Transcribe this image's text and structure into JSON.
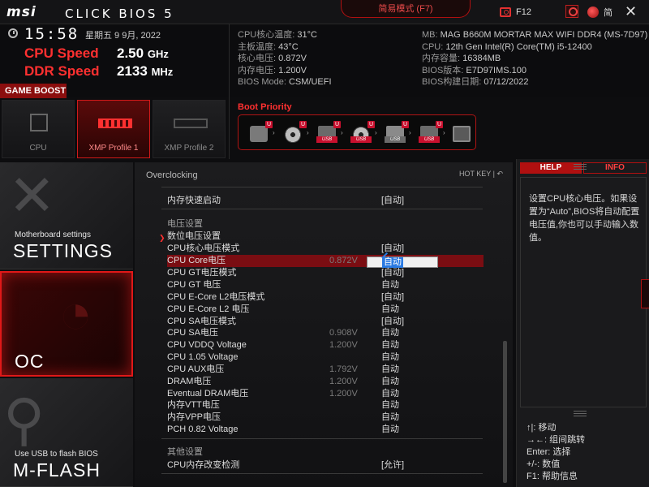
{
  "header": {
    "brand": "msi",
    "title": "CLICK BIOS 5",
    "easy_mode": "简易模式 (F7)",
    "screenshot_key": "F12",
    "language": "简"
  },
  "clock": {
    "time": "15:58",
    "date": "星期五 9 9月, 2022"
  },
  "speeds": {
    "cpu_label": "CPU Speed",
    "cpu_value": "2.50",
    "cpu_unit": "GHz",
    "ddr_label": "DDR Speed",
    "ddr_value": "2133",
    "ddr_unit": "MHz"
  },
  "sysinfo_left": [
    {
      "k": "CPU核心温度: ",
      "v": "31°C"
    },
    {
      "k": "主板温度: ",
      "v": "43°C"
    },
    {
      "k": "核心电压: ",
      "v": "0.872V"
    },
    {
      "k": "内存电压: ",
      "v": "1.200V"
    },
    {
      "k": "BIOS Mode: ",
      "v": "CSM/UEFI"
    }
  ],
  "sysinfo_right": [
    {
      "k": "MB: ",
      "v": "MAG B660M MORTAR MAX WIFI DDR4 (MS-7D97)"
    },
    {
      "k": "CPU: ",
      "v": "12th Gen Intel(R) Core(TM) i5-12400"
    },
    {
      "k": "内存容量: ",
      "v": "16384MB"
    },
    {
      "k": "BIOS版本: ",
      "v": "E7D97IMS.100"
    },
    {
      "k": "BIOS构建日期: ",
      "v": "07/12/2022"
    }
  ],
  "game_boost": {
    "label": "GAME BOOST",
    "tiles": [
      "CPU",
      "XMP Profile 1",
      "XMP Profile 2"
    ]
  },
  "boot": {
    "title": "Boot Priority",
    "devices": [
      {
        "type": "hdd",
        "tag": ""
      },
      {
        "type": "disc",
        "tag": ""
      },
      {
        "type": "usb",
        "tag": "USB"
      },
      {
        "type": "disc",
        "tag": "USB"
      },
      {
        "type": "usb",
        "tag": "USB"
      },
      {
        "type": "usb",
        "tag": "USB"
      },
      {
        "type": "net",
        "tag": ""
      }
    ]
  },
  "nav": {
    "settings_sub": "Motherboard settings",
    "settings": "SETTINGS",
    "oc": "OC",
    "mflash_sub": "Use USB to flash BIOS",
    "mflash": "M-FLASH"
  },
  "main": {
    "title": "Overclocking",
    "hotkey": "HOT KEY  |  ↶",
    "rows": [
      {
        "name": "内存快速启动",
        "cur": "",
        "val": "[自动]",
        "kind": "item"
      },
      {
        "name": "电压设置",
        "cur": "",
        "val": "",
        "kind": "section"
      },
      {
        "name": "数位电压设置",
        "cur": "",
        "val": "",
        "kind": "submenu"
      },
      {
        "name": "CPU核心电压模式",
        "cur": "",
        "val": "[自动]",
        "kind": "item"
      },
      {
        "name": "CPU Core电压",
        "cur": "0.872V",
        "val": "自动",
        "kind": "selected"
      },
      {
        "name": "CPU GT电压模式",
        "cur": "",
        "val": "[自动]",
        "kind": "item"
      },
      {
        "name": "CPU GT 电压",
        "cur": "",
        "val": "自动",
        "kind": "item"
      },
      {
        "name": "CPU E-Core L2电压模式",
        "cur": "",
        "val": "[自动]",
        "kind": "item"
      },
      {
        "name": "CPU E-Core L2 电压",
        "cur": "",
        "val": "自动",
        "kind": "item"
      },
      {
        "name": "CPU SA电压模式",
        "cur": "",
        "val": "[自动]",
        "kind": "item"
      },
      {
        "name": "CPU SA电压",
        "cur": "0.908V",
        "val": "自动",
        "kind": "item"
      },
      {
        "name": "CPU VDDQ Voltage",
        "cur": "1.200V",
        "val": "自动",
        "kind": "item"
      },
      {
        "name": "CPU 1.05 Voltage",
        "cur": "",
        "val": "自动",
        "kind": "item"
      },
      {
        "name": "CPU AUX电压",
        "cur": "1.792V",
        "val": "自动",
        "kind": "item"
      },
      {
        "name": "DRAM电压",
        "cur": "1.200V",
        "val": "自动",
        "kind": "item"
      },
      {
        "name": "Eventual DRAM电压",
        "cur": "1.200V",
        "val": "自动",
        "kind": "item"
      },
      {
        "name": "内存VTT电压",
        "cur": "",
        "val": "自动",
        "kind": "item"
      },
      {
        "name": "内存VPP电压",
        "cur": "",
        "val": "自动",
        "kind": "item"
      },
      {
        "name": "PCH 0.82 Voltage",
        "cur": "",
        "val": "自动",
        "kind": "item"
      },
      {
        "name": "其他设置",
        "cur": "",
        "val": "",
        "kind": "section"
      },
      {
        "name": "CPU内存改变检测",
        "cur": "",
        "val": "[允许]",
        "kind": "item"
      }
    ],
    "selected_input": "自动"
  },
  "help": {
    "help_tab": "HELP",
    "info_tab": "INFO",
    "text": "设置CPU核心电压。如果设置为“Auto”,BIOS将自动配置电压值,你也可以手动输入数值。",
    "keys": [
      "↑|: 移动",
      "→←: 组间跳转",
      "Enter: 选择",
      "+/-: 数值",
      "F1: 帮助信息"
    ]
  },
  "colors": {
    "accent": "#e01818",
    "selected_row": "#7a0d12",
    "input_highlight": "#2a7ae2"
  }
}
